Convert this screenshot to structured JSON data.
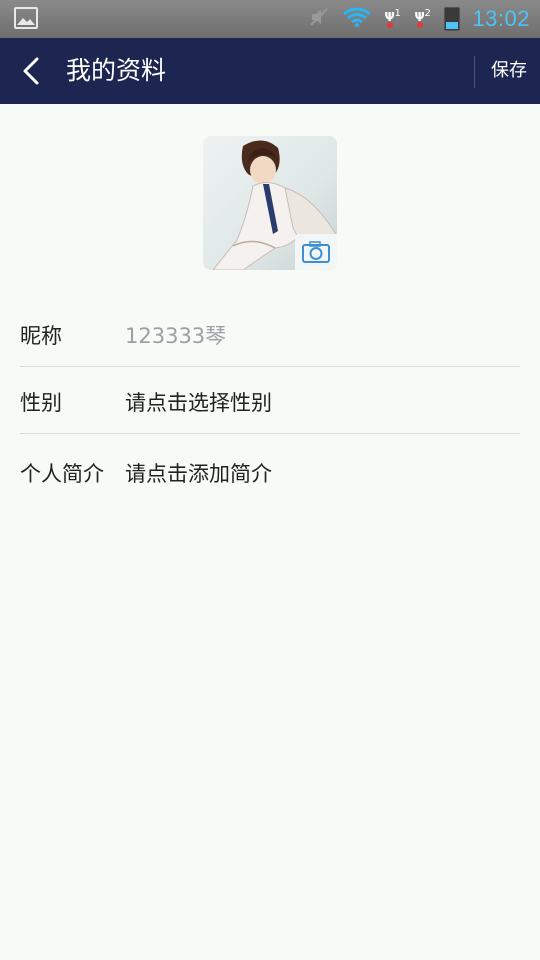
{
  "status_bar": {
    "time": "13:02",
    "icons": [
      "gallery-icon",
      "mute-icon",
      "wifi-icon",
      "sim1-signal-icon",
      "sim2-signal-icon",
      "battery-icon"
    ],
    "sim1_label": "1",
    "sim2_label": "2",
    "time_color": "#4fc3f7"
  },
  "header": {
    "title": "我的资料",
    "save_label": "保存",
    "background": "#1d2650"
  },
  "profile": {
    "avatar_icon": "avatar-image",
    "camera_icon": "camera-icon"
  },
  "fields": [
    {
      "label": "昵称",
      "value": "123333琴",
      "value_color": "#9aa0a6"
    },
    {
      "label": "性别",
      "value": "请点击选择性别",
      "value_color": "#222222"
    },
    {
      "label": "个人简介",
      "value": "请点击添加简介",
      "value_color": "#222222"
    }
  ]
}
